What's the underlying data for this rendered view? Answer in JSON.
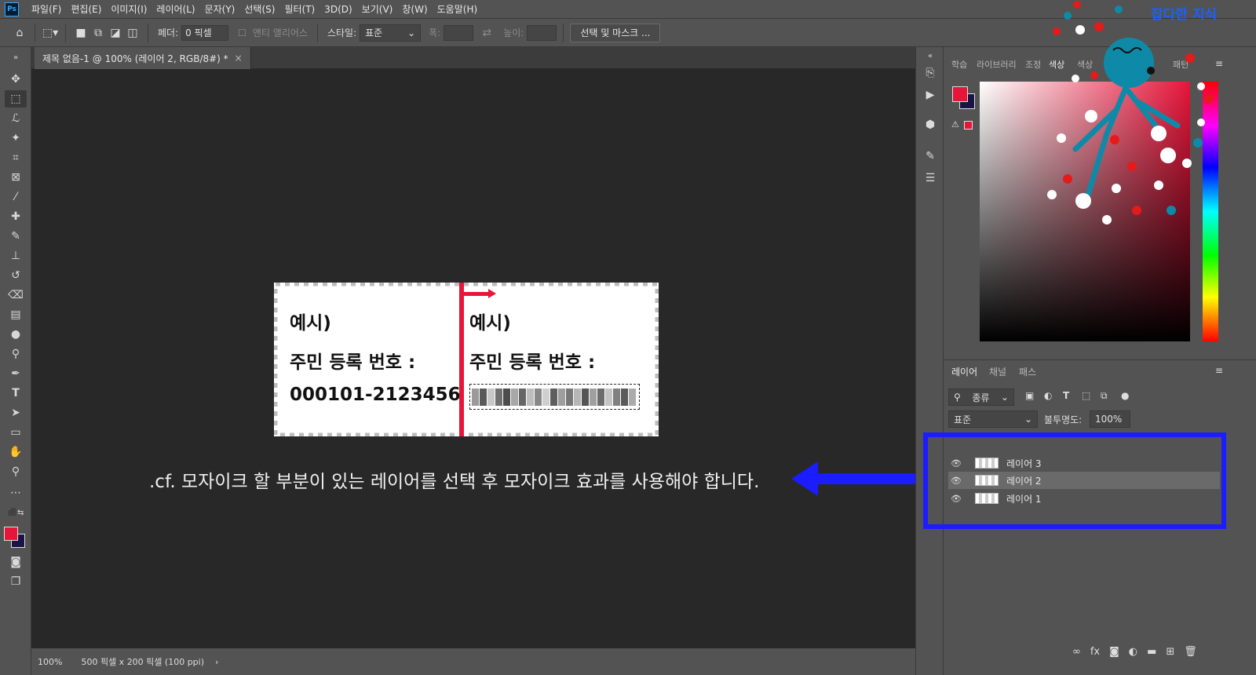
{
  "app": {
    "logo": "Ps"
  },
  "menu": [
    "파일(F)",
    "편집(E)",
    "이미지(I)",
    "레이어(L)",
    "문자(Y)",
    "선택(S)",
    "필터(T)",
    "3D(D)",
    "보기(V)",
    "창(W)",
    "도움말(H)"
  ],
  "options": {
    "feather_label": "페더:",
    "feather_value": "0 픽셀",
    "antialias_label": "앤티 앨리어스",
    "style_label": "스타일:",
    "style_value": "표준",
    "width_label": "폭:",
    "height_label": "높이:",
    "select_mask_button": "선택 및 마스크 ..."
  },
  "document": {
    "tab_title": "제목 없음-1 @ 100% (레이어 2, RGB/8#) *",
    "left_example": "예시)",
    "left_label": "주민 등록 번호 :",
    "left_number": "000101-2123456",
    "right_example": "예시)",
    "right_label": "주민 등록 번호 :"
  },
  "caption": ".cf. 모자이크 할 부분이 있는 레이어를 선택 후 모자이크 효과를 사용해야 합니다.",
  "status": {
    "zoom": "100%",
    "doc_size": "500 픽셀 x 200 픽셀 (100 ppi)"
  },
  "right_panel": {
    "top_tabs": [
      "학습",
      "라이브러리",
      "조정",
      "색상",
      "색상",
      "패턴"
    ],
    "layer_tabs": [
      "레이어",
      "채널",
      "패스"
    ],
    "kind_filter": "종류",
    "blend_mode": "표준",
    "opacity_label": "불투명도:",
    "opacity_value": "100%",
    "layers": [
      {
        "name": "레이어 3",
        "selected": false
      },
      {
        "name": "레이어 2",
        "selected": true
      },
      {
        "name": "레이어 1",
        "selected": false
      }
    ]
  },
  "watermark": "잡다한 지식",
  "colors": {
    "foreground": "#e8153a",
    "background": "#1a1446",
    "annotation": "#1b1cff"
  }
}
